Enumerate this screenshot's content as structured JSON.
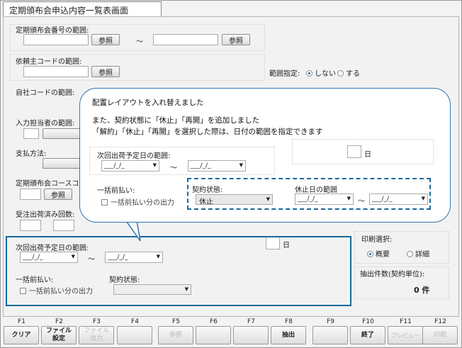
{
  "window": {
    "title": "定期頒布会申込内容一覧表画面"
  },
  "back": {
    "number_range_label": "定期頒布会番号の範囲:",
    "browse_label": "参照",
    "tilde": "～",
    "client_code_label": "依頼主コードの範囲:",
    "range_spec_label": "範囲指定:",
    "range_no": "しない",
    "range_yes": "する",
    "own_code_label": "自社コードの範囲:",
    "staff_label": "入力担当者の範囲:",
    "payment_label": "支払方法:",
    "course_label": "定期頒布会コースコード",
    "ship_count_label": "受注出荷済み回数:",
    "day_label": "日",
    "print_select_label": "印刷選択:",
    "print_summary": "概要",
    "print_detail": "詳細",
    "extract_count_label": "抽出件数(契約単位):",
    "extract_count_value": "0 件"
  },
  "highlight": {
    "next_ship_label": "次回出荷予定日の範囲:",
    "date_placeholder": "___/_/_",
    "tilde": "～",
    "lump_label": "一括前払い:",
    "lump_check": "一括前払い分の出力",
    "contract_label": "契約状態:"
  },
  "callout": {
    "line1": "配置レイアウトを入れ替えました",
    "line2": "また、契約状態に「休止」「再開」を追加しました",
    "line3": "「解約」「休止」「再開」を選択した際は、日付の範囲を指定できます",
    "next_ship_label": "次回出荷予定日の範囲:",
    "date_placeholder": "___/_/_",
    "tilde": "～",
    "lump_label": "一括前払い:",
    "lump_check": "一括前払い分の出力",
    "contract_label": "契約状態:",
    "contract_value": "休止",
    "pause_date_label": "休止日の範囲",
    "day_label": "日"
  },
  "fkeys": [
    {
      "num": "F1",
      "label": "クリア",
      "enabled": true
    },
    {
      "num": "F2",
      "label": "ファイル\n設定",
      "enabled": true
    },
    {
      "num": "F3",
      "label": "ファイル\n出力",
      "enabled": false
    },
    {
      "num": "F4",
      "label": "",
      "enabled": false
    },
    {
      "num": "F5",
      "label": "参照",
      "enabled": false
    },
    {
      "num": "F6",
      "label": "",
      "enabled": false
    },
    {
      "num": "F7",
      "label": "",
      "enabled": false
    },
    {
      "num": "F8",
      "label": "抽出",
      "enabled": true
    },
    {
      "num": "F9",
      "label": "",
      "enabled": false
    },
    {
      "num": "F10",
      "label": "終了",
      "enabled": true
    },
    {
      "num": "F11",
      "label": "プレビュー",
      "enabled": false
    },
    {
      "num": "F12",
      "label": "印刷",
      "enabled": false
    }
  ],
  "colors": {
    "highlight": "#17699b",
    "callout_border": "#2d75b6"
  }
}
